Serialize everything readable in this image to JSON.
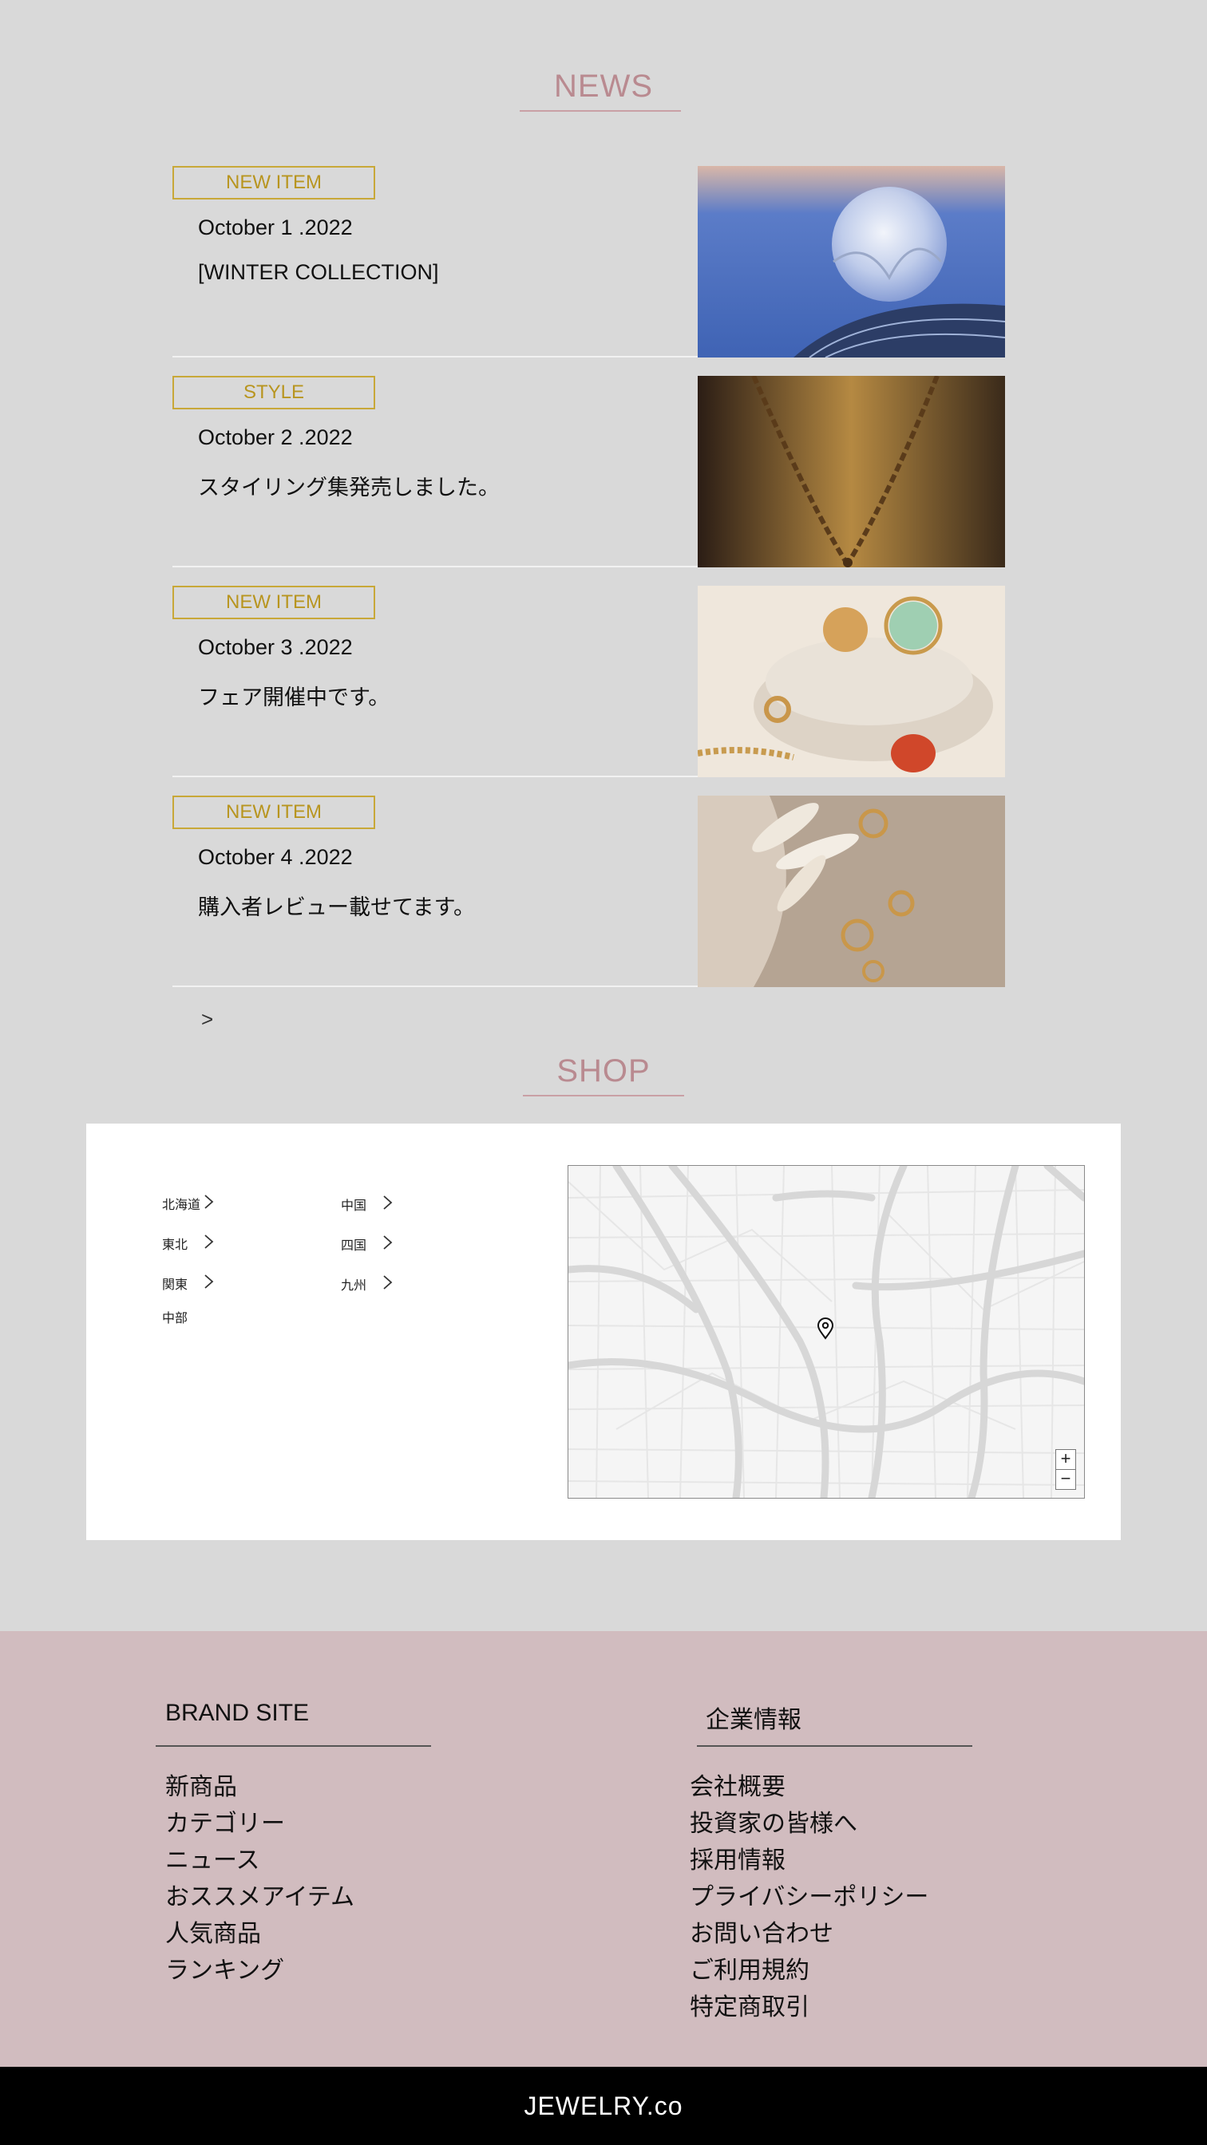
{
  "news": {
    "title": "NEWS",
    "items": [
      {
        "tag": "NEW ITEM",
        "date": "October 1 .2022",
        "text": "[WINTER COLLECTION]",
        "image": "frozen-bubble-photo"
      },
      {
        "tag": "STYLE",
        "date": "October 2 .2022",
        "text": "スタイリング集発売しました。",
        "image": "gold-chain-necklace-photo"
      },
      {
        "tag": "NEW ITEM",
        "date": "October 3 .2022",
        "text": "フェア開催中です。",
        "image": "gemstone-rings-photo"
      },
      {
        "tag": "NEW ITEM",
        "date": "October 4 .2022",
        "text": "購入者レビュー載せてます。",
        "image": "gold-rings-dried-flowers-photo"
      }
    ],
    "more_icon": "chevron-right-icon"
  },
  "shop": {
    "title": "SHOP",
    "regions_left": [
      {
        "label": "北海道",
        "has_arrow": true
      },
      {
        "label": "東北",
        "has_arrow": true
      },
      {
        "label": "関東",
        "has_arrow": true
      },
      {
        "label": "中部",
        "has_arrow": false
      }
    ],
    "regions_right": [
      {
        "label": "中国",
        "has_arrow": true
      },
      {
        "label": "四国",
        "has_arrow": true
      },
      {
        "label": "九州",
        "has_arrow": true
      }
    ],
    "map": {
      "marker_icon": "location-pin-icon",
      "zoom_in": "+",
      "zoom_out": "−"
    }
  },
  "footer": {
    "brand": {
      "heading": "BRAND SITE",
      "links": [
        "新商品",
        "カテゴリー",
        "ニュース",
        "おススメアイテム",
        "人気商品",
        "ランキング"
      ]
    },
    "company": {
      "heading": "企業情報",
      "links": [
        "会社概要",
        "投資家の皆様へ",
        "採用情報",
        "プライバシーポリシー",
        "お問い合わせ",
        "ご利用規約",
        "特定商取引"
      ]
    },
    "brand_name": "JEWELRY.co"
  },
  "colors": {
    "page_bg": "#d9d9d9",
    "section_title": "#b98a90",
    "tag_gold": "#c8a838",
    "footer_bg": "#d1bcbf",
    "bottom_bar": "#000000"
  }
}
